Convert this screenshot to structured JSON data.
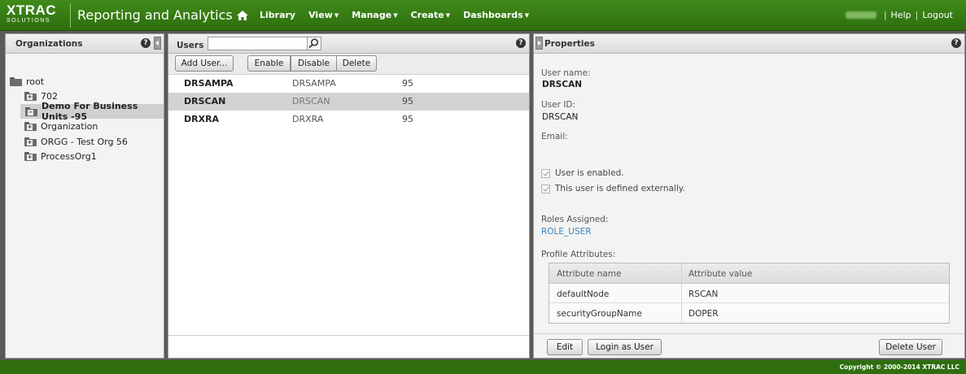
{
  "header": {
    "logo_line1": "XTRAC",
    "logo_line2": "SOLUTIONS",
    "app_title": "Reporting and Analytics",
    "nav": [
      "Library",
      "View",
      "Manage",
      "Create",
      "Dashboards"
    ],
    "help": "Help",
    "logout": "Logout",
    "separator": "|"
  },
  "organizations": {
    "title": "Organizations",
    "help": "?",
    "tree": [
      {
        "label": "root",
        "level": 0,
        "open": true
      },
      {
        "label": "702",
        "level": 1
      },
      {
        "label": "Demo For Business Units -95",
        "level": 1,
        "selected": true
      },
      {
        "label": "Organization",
        "level": 1
      },
      {
        "label": "ORGG - Test Org 56",
        "level": 1
      },
      {
        "label": "ProcessOrg1",
        "level": 1
      }
    ]
  },
  "users": {
    "title": "Users",
    "search_value": "",
    "help": "?",
    "buttons": {
      "add": "Add User...",
      "enable": "Enable",
      "disable": "Disable",
      "delete": "Delete"
    },
    "rows": [
      {
        "name": "DRSAMPA",
        "id": "DRSAMPA",
        "org": "95"
      },
      {
        "name": "DRSCAN",
        "id": "DRSCAN",
        "org": "95",
        "selected": true
      },
      {
        "name": "DRXRA",
        "id": "DRXRA",
        "org": "95"
      }
    ]
  },
  "properties": {
    "title": "Properties",
    "help": "?",
    "username_label": "User name:",
    "username_value": "DRSCAN",
    "userid_label": "User ID:",
    "userid_value": "DRSCAN",
    "email_label": "Email:",
    "enabled_label": "User is enabled.",
    "external_label": "This user is defined externally.",
    "roles_label": "Roles Assigned:",
    "role_value": "ROLE_USER",
    "profile_label": "Profile Attributes:",
    "attr_head_name": "Attribute name",
    "attr_head_value": "Attribute value",
    "attributes": [
      {
        "name": "defaultNode",
        "value": "RSCAN"
      },
      {
        "name": "securityGroupName",
        "value": "DOPER"
      }
    ],
    "edit_button": "Edit",
    "login_button": "Login as User",
    "delete_button": "Delete User"
  },
  "footer": {
    "copyright": "Copyright © 2000-2014 XTRAC LLC"
  },
  "colors": {
    "brand_green": "#2e6e0e",
    "link_blue": "#3a84c0",
    "selection": "#d2d2d2"
  }
}
